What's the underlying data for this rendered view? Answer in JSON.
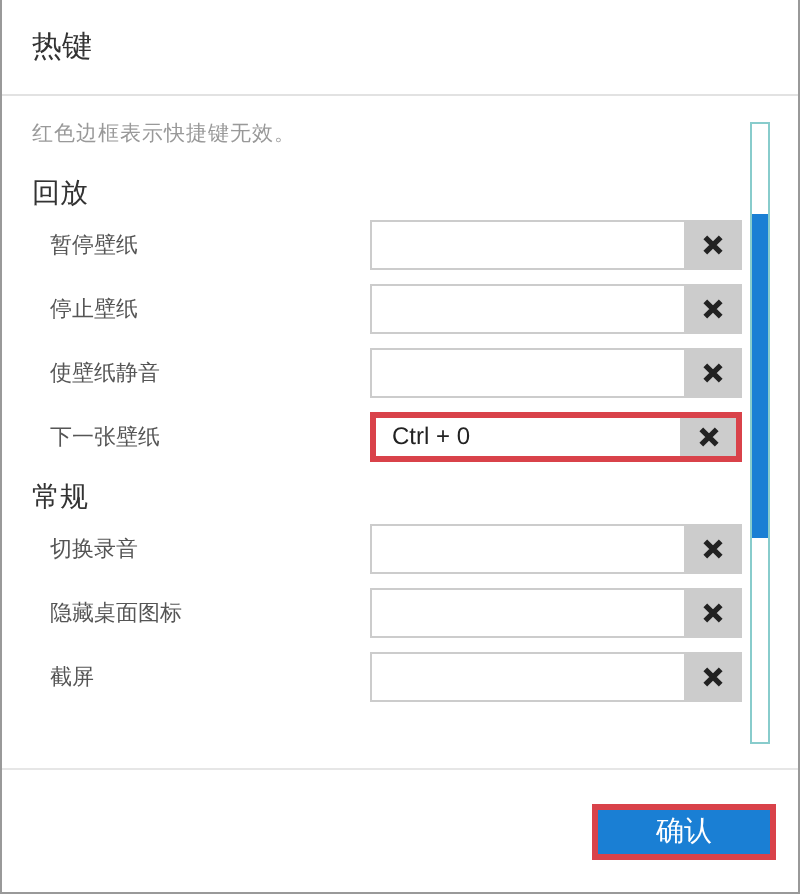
{
  "dialog": {
    "title": "热键"
  },
  "hint": "红色边框表示快捷键无效。",
  "sections": [
    {
      "title": "回放",
      "rows": [
        {
          "label": "暂停壁纸",
          "value": "",
          "invalid": false
        },
        {
          "label": "停止壁纸",
          "value": "",
          "invalid": false
        },
        {
          "label": "使壁纸静音",
          "value": "",
          "invalid": false
        },
        {
          "label": "下一张壁纸",
          "value": "Ctrl + 0",
          "invalid": true
        }
      ]
    },
    {
      "title": "常规",
      "rows": [
        {
          "label": "切换录音",
          "value": "",
          "invalid": false
        },
        {
          "label": "隐藏桌面图标",
          "value": "",
          "invalid": false
        },
        {
          "label": "截屏",
          "value": "",
          "invalid": false
        }
      ]
    }
  ],
  "confirm_button": {
    "label": "确认"
  }
}
